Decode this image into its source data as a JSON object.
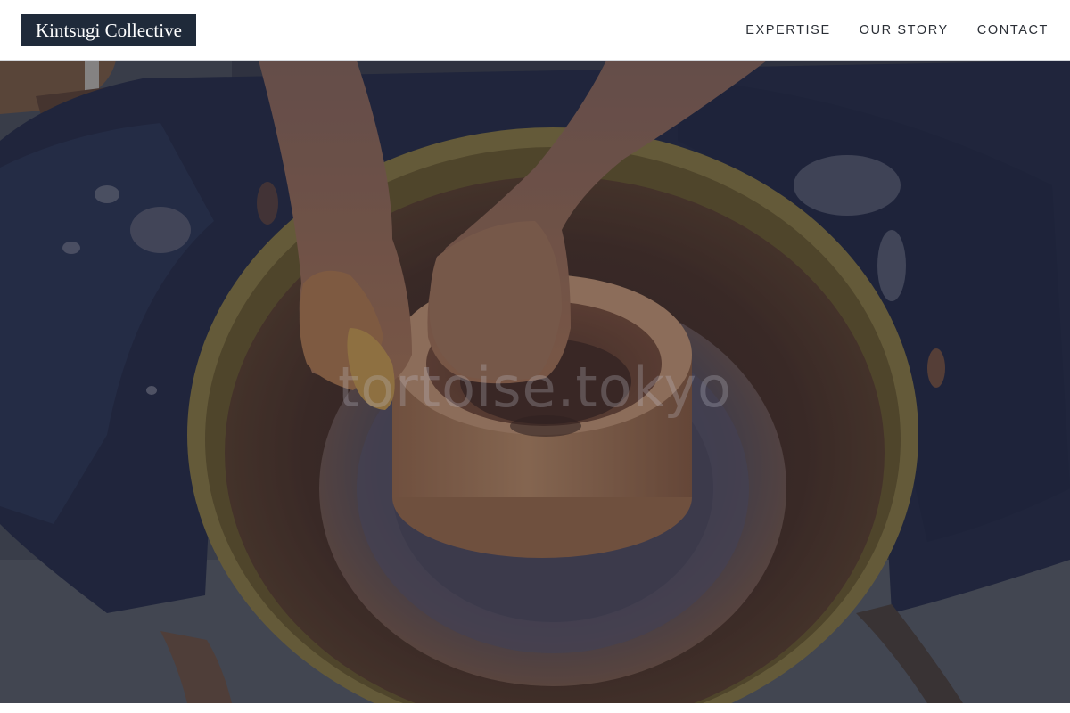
{
  "header": {
    "logo_text": "Kintsugi Collective",
    "nav": [
      {
        "label": "EXPERTISE"
      },
      {
        "label": "OUR STORY"
      },
      {
        "label": "CONTACT"
      }
    ]
  },
  "hero": {
    "image_alt": "Hands shaping clay on a pottery wheel",
    "watermark": "tortoise.tokyo"
  },
  "colors": {
    "logo_background": "#1f2a3a",
    "nav_text": "#2b2f36",
    "header_background": "#ffffff"
  }
}
